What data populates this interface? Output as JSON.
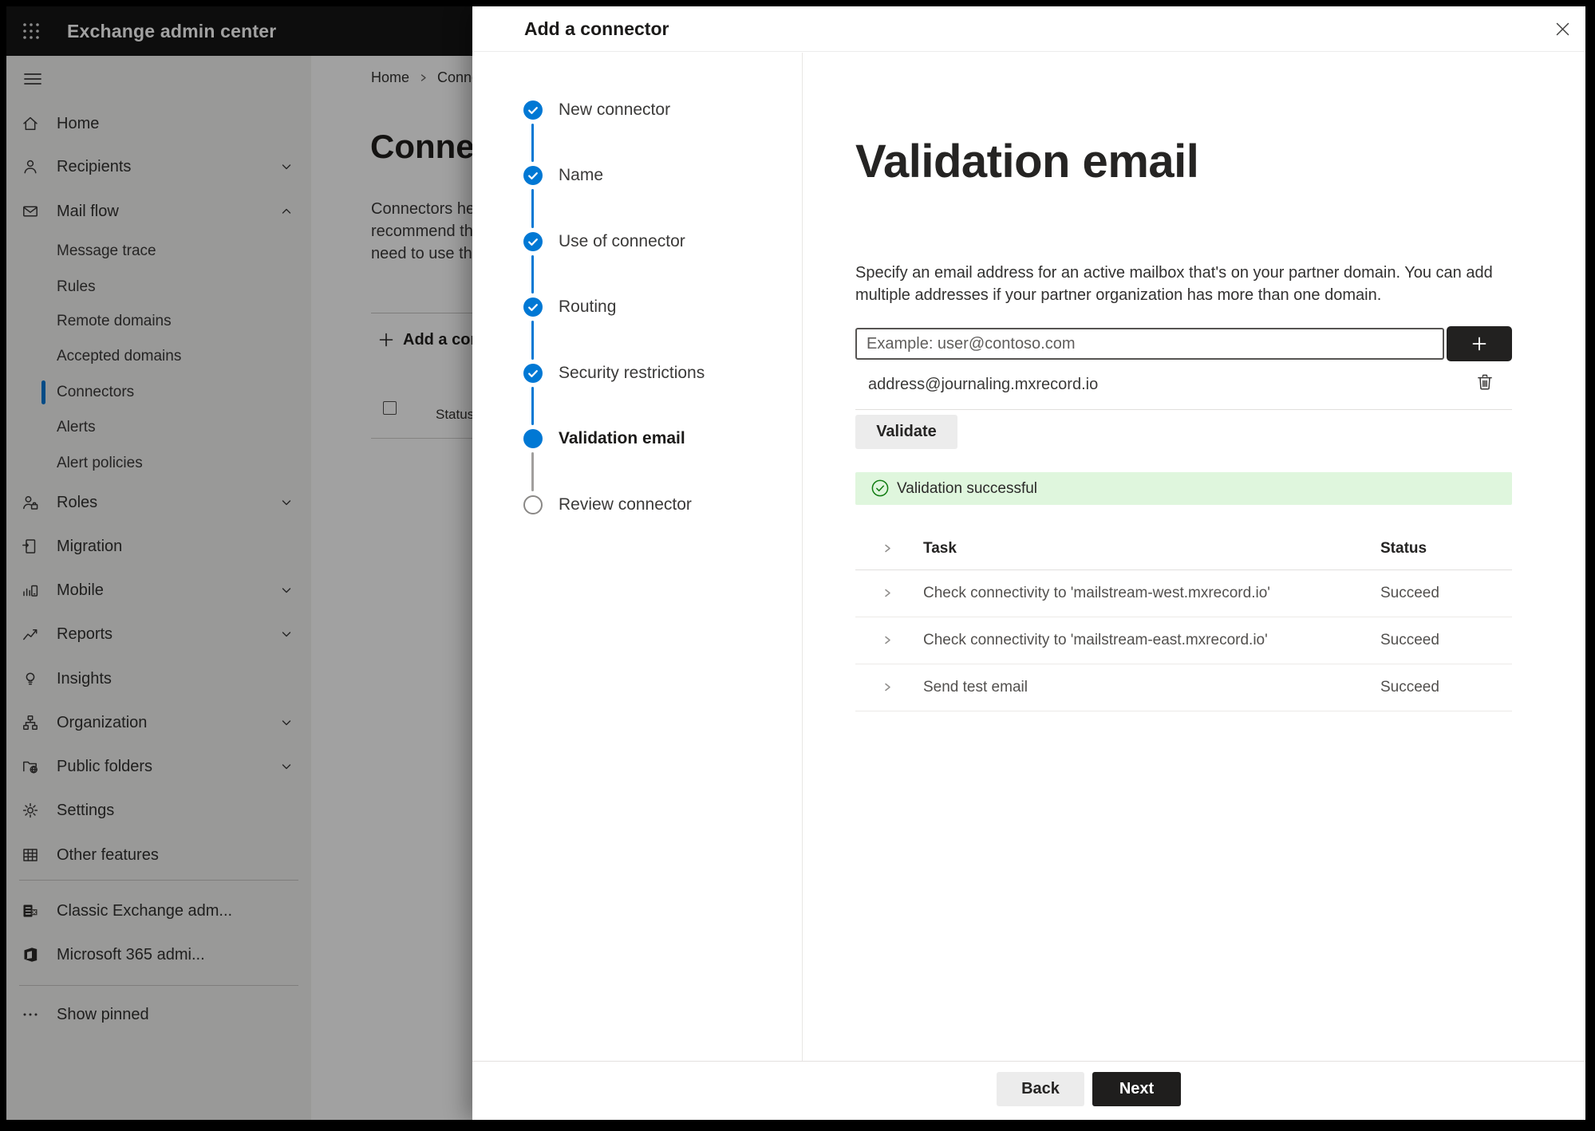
{
  "colors": {
    "accent": "#0078d4",
    "success_bg": "#dff6dd",
    "success_green": "#107c10",
    "dark_button": "#1f1e1d"
  },
  "topbar": {
    "app_title": "Exchange admin center"
  },
  "sidebar": {
    "items": [
      {
        "label": "Home",
        "icon": "home",
        "type": "main"
      },
      {
        "label": "Recipients",
        "icon": "person",
        "type": "main",
        "chevron": "down"
      },
      {
        "label": "Mail flow",
        "icon": "mail",
        "type": "main",
        "chevron": "up"
      },
      {
        "label": "Message trace",
        "type": "sub"
      },
      {
        "label": "Rules",
        "type": "sub"
      },
      {
        "label": "Remote domains",
        "type": "sub"
      },
      {
        "label": "Accepted domains",
        "type": "sub"
      },
      {
        "label": "Connectors",
        "type": "sub",
        "selected": true
      },
      {
        "label": "Alerts",
        "type": "sub"
      },
      {
        "label": "Alert policies",
        "type": "sub"
      },
      {
        "label": "Roles",
        "icon": "roles",
        "type": "main",
        "chevron": "down"
      },
      {
        "label": "Migration",
        "icon": "migration",
        "type": "main"
      },
      {
        "label": "Mobile",
        "icon": "mobile",
        "type": "main",
        "chevron": "down"
      },
      {
        "label": "Reports",
        "icon": "reports",
        "type": "main",
        "chevron": "down"
      },
      {
        "label": "Insights",
        "icon": "insights",
        "type": "main"
      },
      {
        "label": "Organization",
        "icon": "organization",
        "type": "main",
        "chevron": "down"
      },
      {
        "label": "Public folders",
        "icon": "folders",
        "type": "main",
        "chevron": "down"
      },
      {
        "label": "Settings",
        "icon": "settings",
        "type": "main"
      },
      {
        "label": "Other features",
        "icon": "grid",
        "type": "main"
      },
      {
        "type": "divider"
      },
      {
        "label": "Classic Exchange adm...",
        "icon": "exchange",
        "type": "main"
      },
      {
        "label": "Microsoft 365 admi...",
        "icon": "office",
        "type": "main"
      },
      {
        "type": "divider"
      },
      {
        "label": "Show pinned",
        "icon": "ellipsis",
        "type": "main"
      }
    ]
  },
  "page": {
    "breadcrumb": {
      "home": "Home",
      "current": "Connectors"
    },
    "title": "Connectors",
    "intro_lines": [
      "Connectors help",
      "recommend that",
      "need to use them"
    ],
    "add_button": "Add a connector",
    "column_header": "Status"
  },
  "wizard": {
    "title": "Add a connector",
    "steps": [
      {
        "label": "New connector",
        "state": "complete"
      },
      {
        "label": "Name",
        "state": "complete"
      },
      {
        "label": "Use of connector",
        "state": "complete"
      },
      {
        "label": "Routing",
        "state": "complete"
      },
      {
        "label": "Security restrictions",
        "state": "complete"
      },
      {
        "label": "Validation email",
        "state": "current"
      },
      {
        "label": "Review connector",
        "state": "upcoming"
      }
    ]
  },
  "panel": {
    "heading": "Validation email",
    "description_line1": "Specify an email address for an active mailbox that's on your partner domain. You can add",
    "description_line2": "multiple addresses if your partner organization has more than one domain.",
    "email_input": {
      "value": "",
      "placeholder": "Example: user@contoso.com"
    },
    "added_address": "address@journaling.mxrecord.io",
    "validate_button": "Validate",
    "status_banner": "Validation successful",
    "table": {
      "headers": {
        "task": "Task",
        "status": "Status"
      },
      "rows": [
        {
          "task": "Check connectivity to 'mailstream-west.mxrecord.io'",
          "status": "Succeed"
        },
        {
          "task": "Check connectivity to 'mailstream-east.mxrecord.io'",
          "status": "Succeed"
        },
        {
          "task": "Send test email",
          "status": "Succeed"
        }
      ]
    },
    "back_button": "Back",
    "next_button": "Next"
  }
}
